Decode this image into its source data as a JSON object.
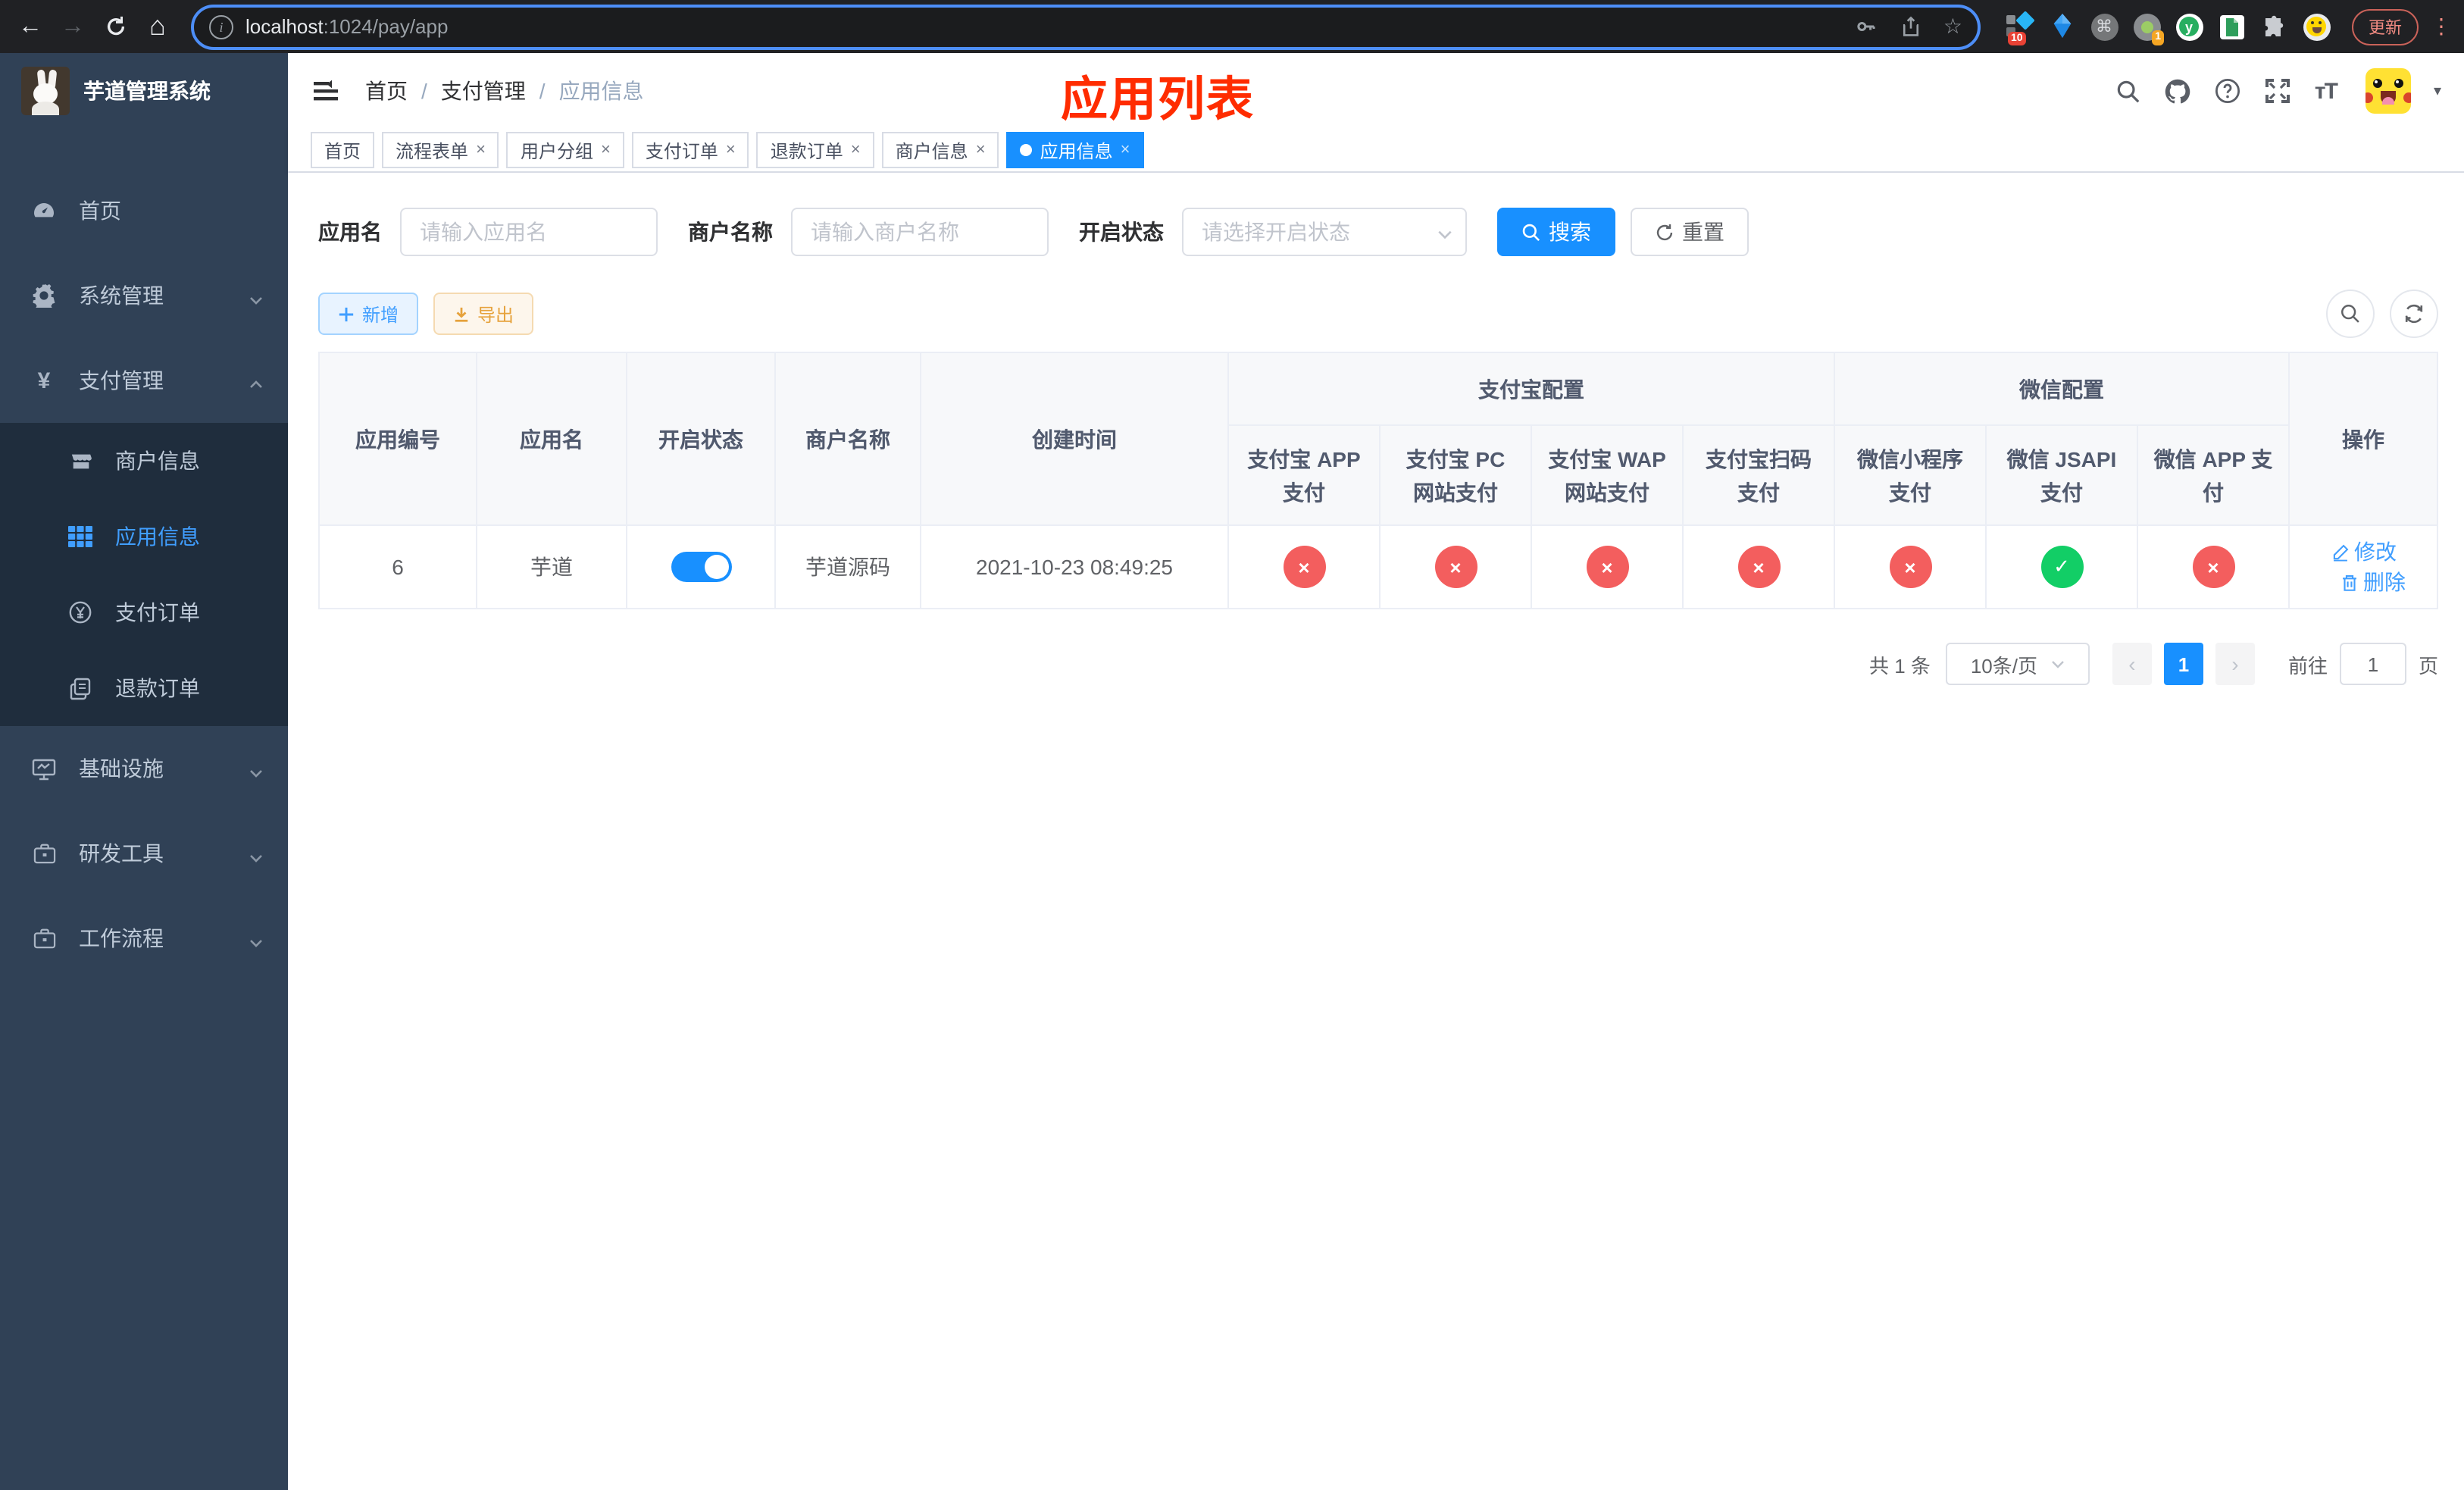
{
  "browser": {
    "url": {
      "host": "localhost",
      "path": ":1024/pay/app"
    },
    "update_button": "更新",
    "ext_badge_ten": "10",
    "ext_badge_one": "1"
  },
  "icons": {
    "back": "←",
    "forward": "→",
    "home": "⌂",
    "star": "☆",
    "command": "⌘",
    "dots": "⋮",
    "caret_down": "▾",
    "close": "×",
    "check": "✓",
    "cross": "×",
    "prev": "‹",
    "next": "›",
    "font_size": "ᴛT",
    "yen": "¥"
  },
  "sidebar": {
    "app_title": "芋道管理系统",
    "menu": [
      {
        "label": "首页"
      },
      {
        "label": "系统管理"
      },
      {
        "label": "支付管理"
      },
      {
        "label": "商户信息"
      },
      {
        "label": "应用信息"
      },
      {
        "label": "支付订单"
      },
      {
        "label": "退款订单"
      },
      {
        "label": "基础设施"
      },
      {
        "label": "研发工具"
      },
      {
        "label": "工作流程"
      }
    ]
  },
  "navbar": {
    "breadcrumb": {
      "home": "首页",
      "section": "支付管理",
      "current": "应用信息",
      "separator": "/"
    },
    "overlay_title": "应用列表"
  },
  "tabs": [
    {
      "label": "首页"
    },
    {
      "label": "流程表单"
    },
    {
      "label": "用户分组"
    },
    {
      "label": "支付订单"
    },
    {
      "label": "退款订单"
    },
    {
      "label": "商户信息"
    },
    {
      "label": "应用信息"
    }
  ],
  "filters": {
    "app_name_label": "应用名",
    "app_name_placeholder": "请输入应用名",
    "merchant_label": "商户名称",
    "merchant_placeholder": "请输入商户名称",
    "status_label": "开启状态",
    "status_placeholder": "请选择开启状态",
    "search_button": "搜索",
    "reset_button": "重置"
  },
  "toolbar": {
    "add_button": "新增",
    "export_button": "导出"
  },
  "table": {
    "headers": {
      "app_id": "应用编号",
      "app_name": "应用名",
      "status": "开启状态",
      "merchant": "商户名称",
      "create_time": "创建时间",
      "alipay_group": "支付宝配置",
      "wechat_group": "微信配置",
      "actions": "操作",
      "channels": [
        "支付宝 APP 支付",
        "支付宝 PC 网站支付",
        "支付宝 WAP 网站支付",
        "支付宝扫码支付",
        "微信小程序支付",
        "微信 JSAPI 支付",
        "微信 APP 支付"
      ]
    },
    "rows": [
      {
        "app_id": "6",
        "app_name": "芋道",
        "status_on": true,
        "merchant": "芋道源码",
        "create_time": "2021-10-23 08:49:25",
        "channel_enabled": [
          false,
          false,
          false,
          false,
          false,
          true,
          false
        ],
        "edit_label": "修改",
        "delete_label": "删除"
      }
    ]
  },
  "pagination": {
    "total": "共 1 条",
    "page_size": "10条/页",
    "page": "1",
    "goto_prefix": "前往",
    "goto_value": "1",
    "goto_suffix": "页"
  },
  "colors": {
    "accent": "#1890ff",
    "link": "#409eff",
    "danger": "#f35e5e",
    "success": "#12ce66",
    "overlay_red": "#ff2c00"
  }
}
